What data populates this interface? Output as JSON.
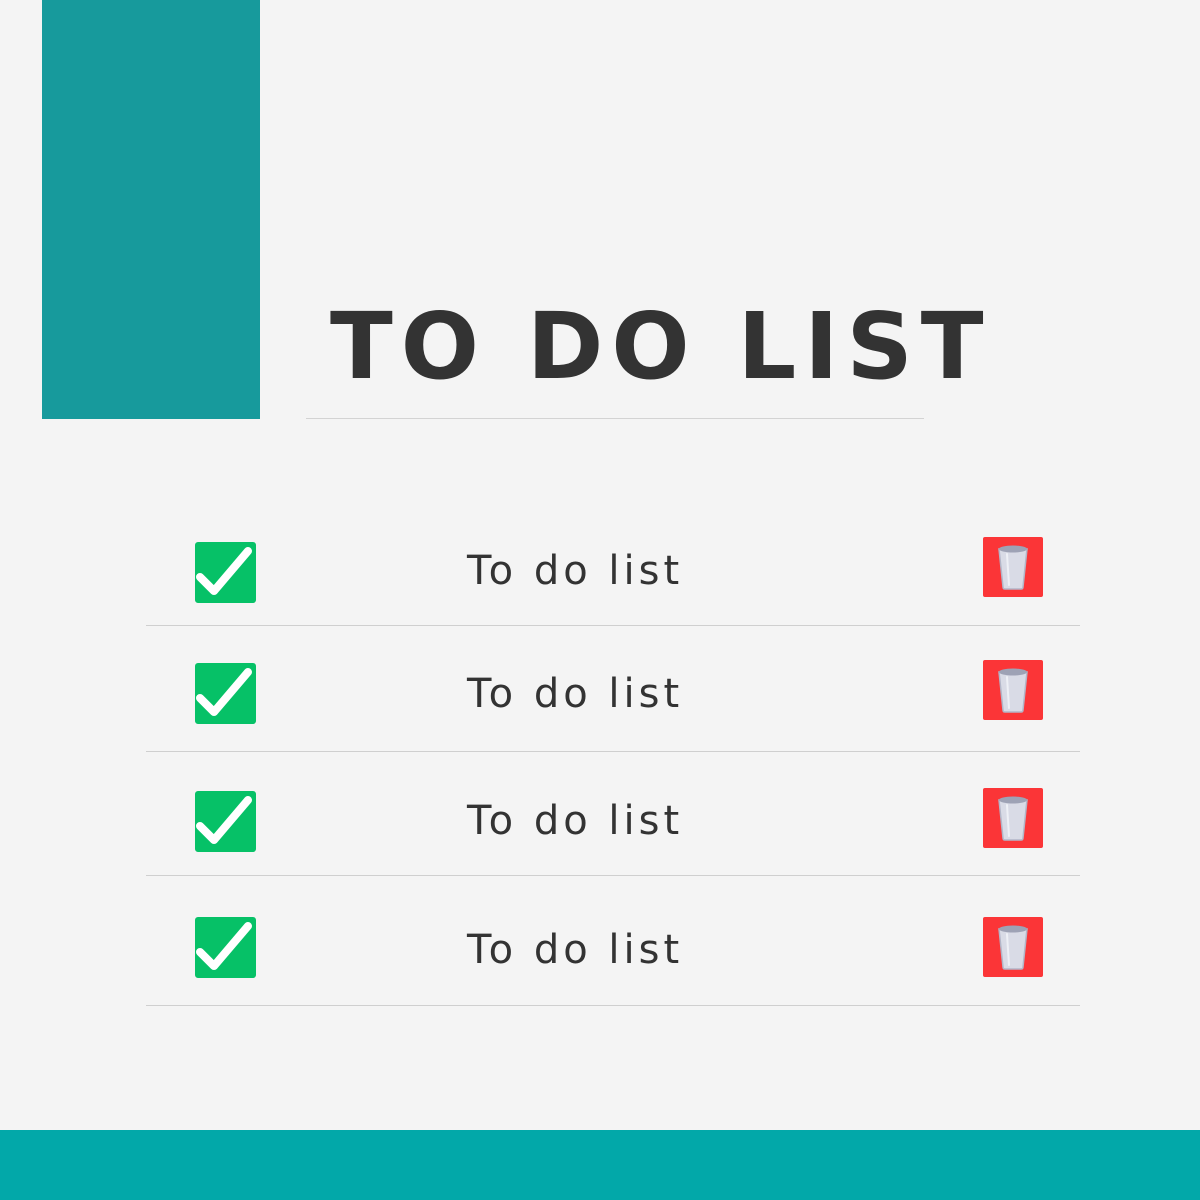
{
  "header": {
    "title": "TO DO LIST"
  },
  "todo": {
    "items": [
      {
        "label": "To do list",
        "completed": true,
        "check_icon": "check-box-icon",
        "delete_icon": "trash-icon"
      },
      {
        "label": "To do list",
        "completed": true,
        "check_icon": "check-box-icon",
        "delete_icon": "trash-icon"
      },
      {
        "label": "To do list",
        "completed": true,
        "check_icon": "check-box-icon",
        "delete_icon": "trash-icon"
      },
      {
        "label": "To do list",
        "completed": true,
        "check_icon": "check-box-icon",
        "delete_icon": "trash-icon"
      }
    ]
  },
  "colors": {
    "accent_teal": "#179a9c",
    "bottom_band": "#02a8a9",
    "check_green": "#06c167",
    "delete_red": "#fb3537",
    "text": "#333333",
    "background": "#f4f4f4"
  }
}
